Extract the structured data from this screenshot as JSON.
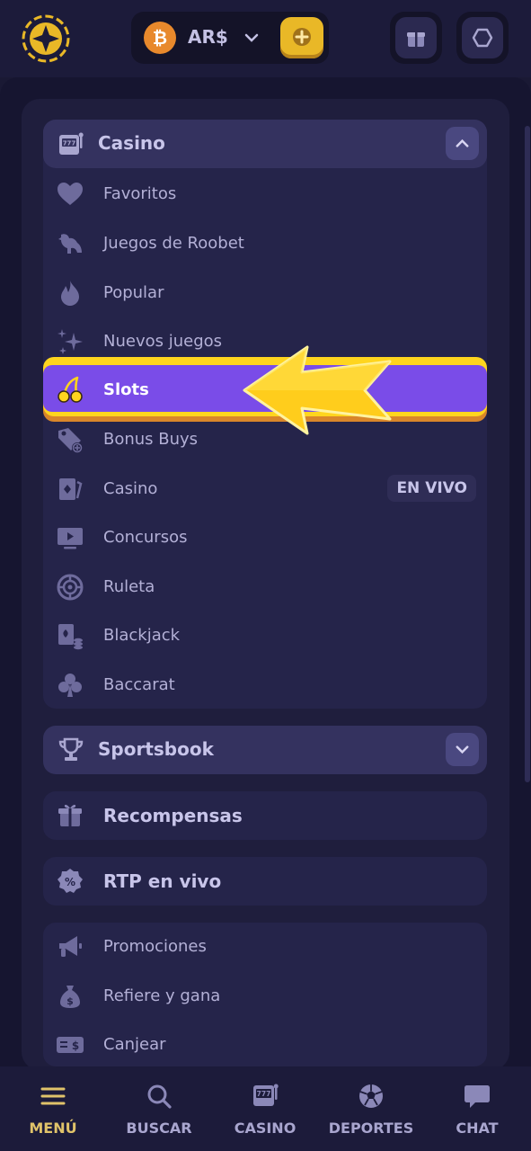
{
  "topbar": {
    "currency": "AR$",
    "btc_symbol": "₿"
  },
  "casino": {
    "title": "Casino",
    "items": [
      {
        "label": "Favoritos"
      },
      {
        "label": "Juegos de Roobet"
      },
      {
        "label": "Popular"
      },
      {
        "label": "Nuevos juegos"
      },
      {
        "label": "Slots",
        "active": true
      },
      {
        "label": "Bonus Buys"
      },
      {
        "label": "Casino",
        "badge": "EN VIVO"
      },
      {
        "label": "Concursos"
      },
      {
        "label": "Ruleta"
      },
      {
        "label": "Blackjack"
      },
      {
        "label": "Baccarat"
      }
    ]
  },
  "sportsbook": {
    "title": "Sportsbook"
  },
  "rewards": {
    "title": "Recompensas"
  },
  "rtp": {
    "title": "RTP en vivo"
  },
  "extra": {
    "items": [
      {
        "label": "Promociones"
      },
      {
        "label": "Refiere y gana"
      },
      {
        "label": "Canjear"
      }
    ]
  },
  "bottomnav": [
    {
      "label": "MENÚ",
      "icon": "menu-icon",
      "active": true
    },
    {
      "label": "BUSCAR",
      "icon": "search-icon"
    },
    {
      "label": "CASINO",
      "icon": "slot-machine-icon"
    },
    {
      "label": "DEPORTES",
      "icon": "soccer-ball-icon"
    },
    {
      "label": "CHAT",
      "icon": "chat-icon"
    }
  ],
  "colors": {
    "accent": "#7a4ce8",
    "highlight": "#ffd51e",
    "background": "#1a1934"
  }
}
